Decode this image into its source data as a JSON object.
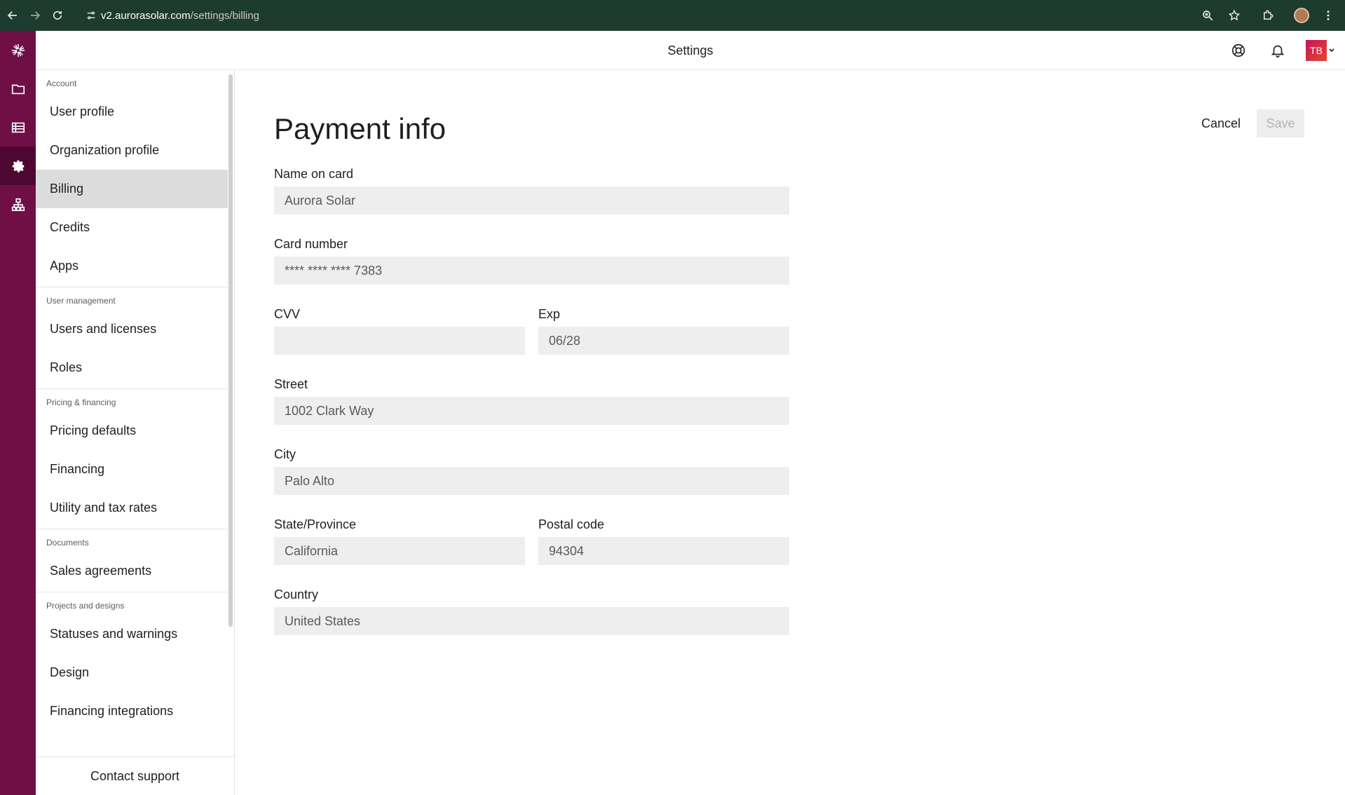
{
  "browser": {
    "url_host": "v2.aurorasolar.com",
    "url_path": "/settings/billing"
  },
  "topbar": {
    "title": "Settings",
    "avatar_initials": "TB"
  },
  "sidebar": {
    "sections": [
      {
        "label": "Account",
        "items": [
          "User profile",
          "Organization profile",
          "Billing",
          "Credits",
          "Apps"
        ]
      },
      {
        "label": "User management",
        "items": [
          "Users and licenses",
          "Roles"
        ]
      },
      {
        "label": "Pricing & financing",
        "items": [
          "Pricing defaults",
          "Financing",
          "Utility and tax rates"
        ]
      },
      {
        "label": "Documents",
        "items": [
          "Sales agreements"
        ]
      },
      {
        "label": "Projects and designs",
        "items": [
          "Statuses and warnings",
          "Design",
          "Financing integrations"
        ]
      }
    ],
    "active_item": "Billing",
    "footer": "Contact support"
  },
  "main": {
    "title": "Payment info",
    "cancel_label": "Cancel",
    "save_label": "Save",
    "fields": {
      "name_on_card": {
        "label": "Name on card",
        "value": "Aurora Solar"
      },
      "card_number": {
        "label": "Card number",
        "value": "**** **** **** 7383"
      },
      "cvv": {
        "label": "CVV",
        "value": ""
      },
      "exp": {
        "label": "Exp",
        "value": "06/28"
      },
      "street": {
        "label": "Street",
        "value": "1002 Clark Way"
      },
      "city": {
        "label": "City",
        "value": "Palo Alto"
      },
      "state": {
        "label": "State/Province",
        "value": "California"
      },
      "postal": {
        "label": "Postal code",
        "value": "94304"
      },
      "country": {
        "label": "Country",
        "value": "United States"
      }
    }
  },
  "colors": {
    "rail": "#6f0f46",
    "chrome": "#1e3b2f",
    "active_nav": "#dcdcdc",
    "input_bg": "#eeeeee"
  }
}
